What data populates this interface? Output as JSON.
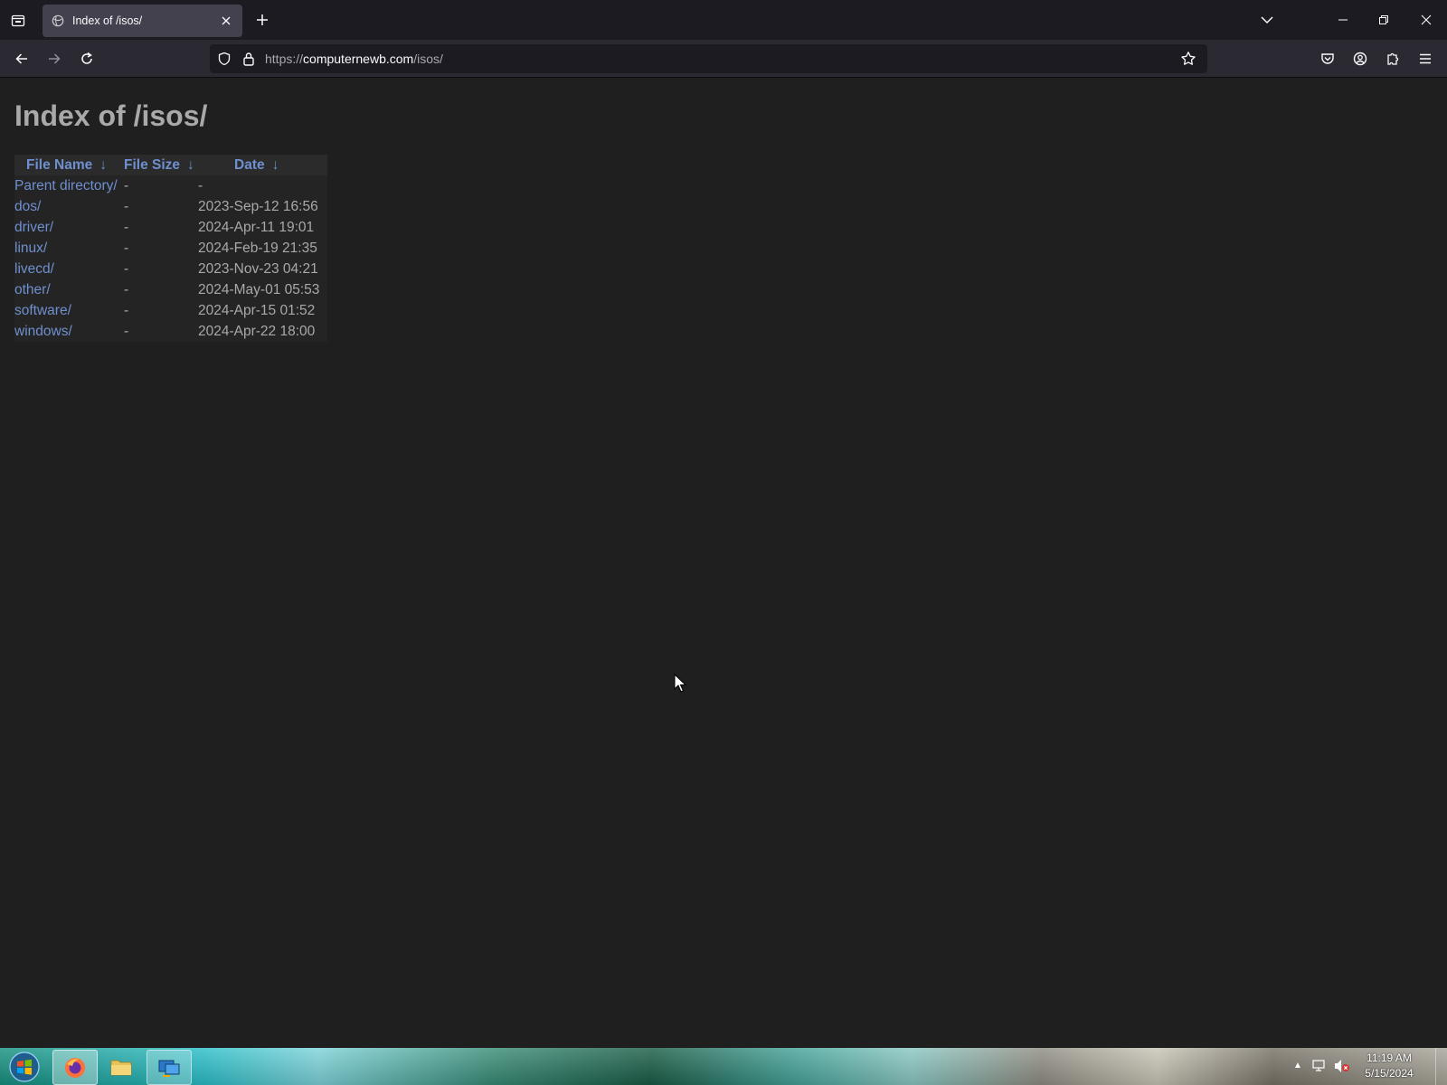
{
  "browser": {
    "tab": {
      "title": "Index of /isos/",
      "favicon": "folder-globe-icon"
    },
    "url": {
      "prefix": "https://",
      "host": "computernewb.com",
      "path": "/isos/"
    }
  },
  "page": {
    "title": "Index of /isos/",
    "table": {
      "headers": {
        "name": "File Name",
        "size": "File Size",
        "date": "Date",
        "sort_arrow": "↓"
      },
      "rows": [
        {
          "name": "Parent directory/",
          "size": "-",
          "date": "-"
        },
        {
          "name": "dos/",
          "size": "-",
          "date": "2023-Sep-12 16:56"
        },
        {
          "name": "driver/",
          "size": "-",
          "date": "2024-Apr-11 19:01"
        },
        {
          "name": "linux/",
          "size": "-",
          "date": "2024-Feb-19 21:35"
        },
        {
          "name": "livecd/",
          "size": "-",
          "date": "2023-Nov-23 04:21"
        },
        {
          "name": "other/",
          "size": "-",
          "date": "2024-May-01 05:53"
        },
        {
          "name": "software/",
          "size": "-",
          "date": "2024-Apr-15 01:52"
        },
        {
          "name": "windows/",
          "size": "-",
          "date": "2024-Apr-22 18:00"
        }
      ]
    }
  },
  "taskbar": {
    "apps": [
      "firefox-icon",
      "file-explorer-icon",
      "remote-desktop-icon"
    ],
    "clock": {
      "time": "11:19 AM",
      "date": "5/15/2024"
    }
  },
  "colors": {
    "page_bg": "#1f1f1f",
    "link": "#6f8fcf",
    "text": "#a9a9a9",
    "tabbar_bg": "#1c1b22",
    "toolbar_bg": "#2b2a33"
  }
}
